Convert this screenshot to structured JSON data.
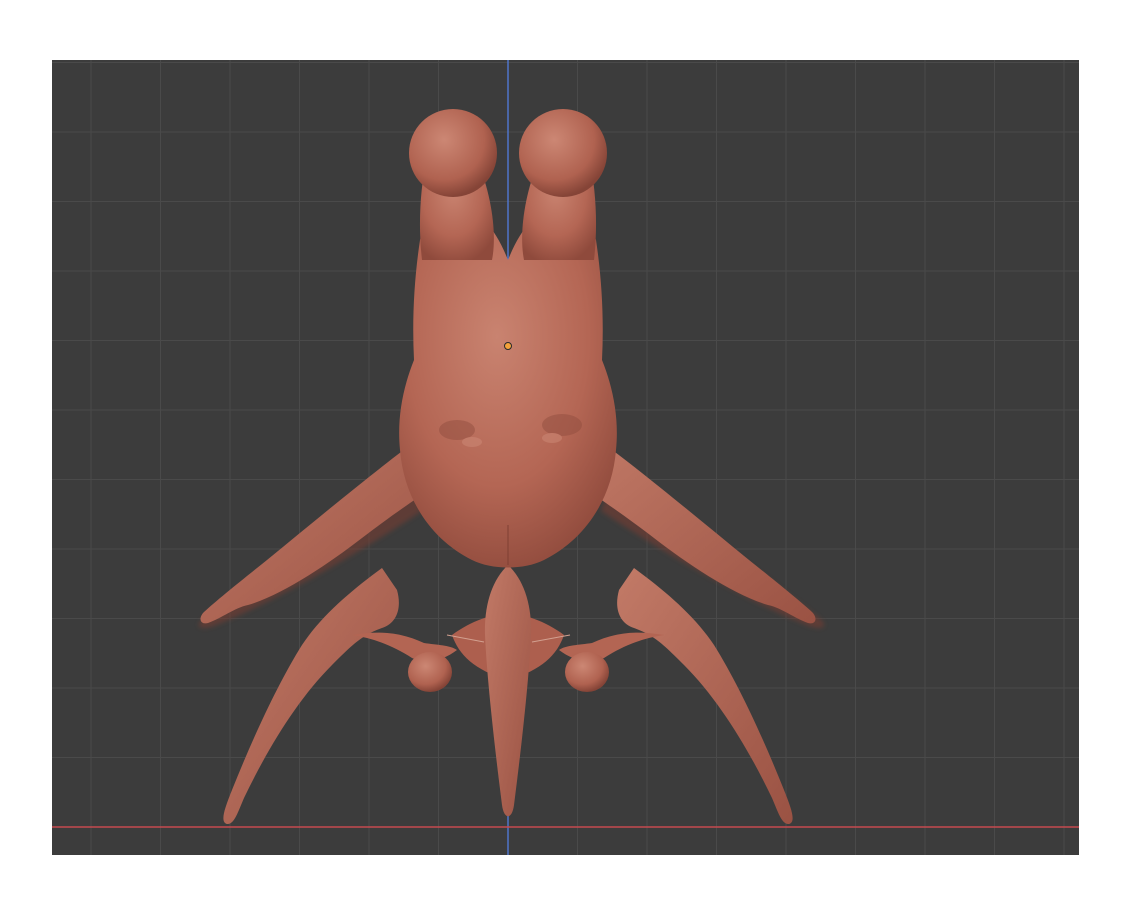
{
  "viewport": {
    "view": "front-orthographic",
    "background_color": "#3c3c3c",
    "grid": true,
    "grid_color": "#4a4a4a",
    "axes": {
      "z_axis_color": "#4f74c9",
      "x_axis_color": "#c54a4f"
    },
    "object": {
      "name_icon": "sculpted-creature-mesh",
      "material_color": "#b86a58",
      "shadow_color": "#7a3d33",
      "highlight_color": "#c9806e",
      "origin_icon": "object-origin-dot",
      "origin_color": "#f4a23a"
    }
  }
}
